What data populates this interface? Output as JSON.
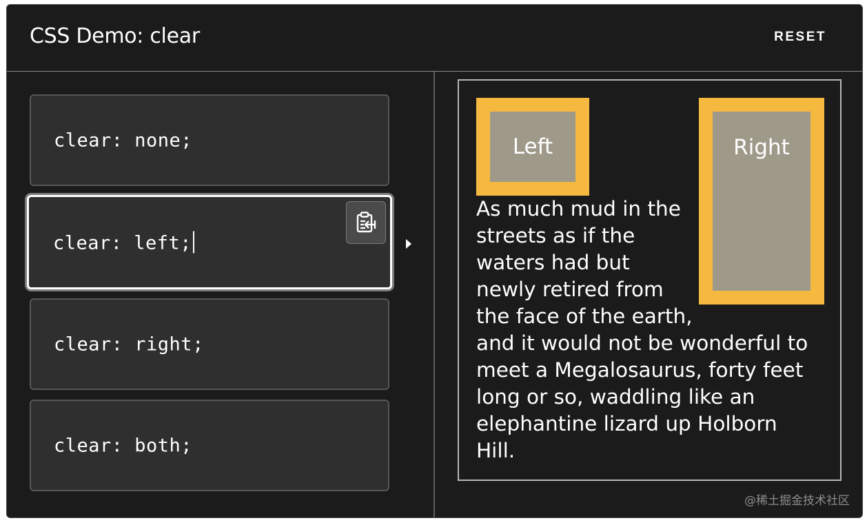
{
  "header": {
    "title": "CSS Demo: clear",
    "reset_label": "RESET"
  },
  "editor": {
    "options": [
      {
        "code": "clear: none;",
        "selected": false
      },
      {
        "code": "clear: left;",
        "selected": true
      },
      {
        "code": "clear: right;",
        "selected": false
      },
      {
        "code": "clear: both;",
        "selected": false
      }
    ],
    "copy_icon": "clipboard-copy-icon",
    "run_icon": "triangle-right-icon"
  },
  "output": {
    "left_box_label": "Left",
    "right_box_label": "Right",
    "paragraph_lines": [
      "As much mud in the",
      "streets as if the",
      "waters had but",
      "newly retired from",
      "the face of the earth,",
      "and it would not be wonderful to",
      "meet a Megalosaurus, forty feet",
      "long or so, waddling like an",
      "elephantine lizard up Holborn",
      "Hill."
    ]
  },
  "colors": {
    "float_border": "#f5b940",
    "float_fill": "#9f998a",
    "panel_background": "#1b1b1b",
    "option_background": "#2f2f2f"
  },
  "watermark": "@稀土掘金技术社区"
}
